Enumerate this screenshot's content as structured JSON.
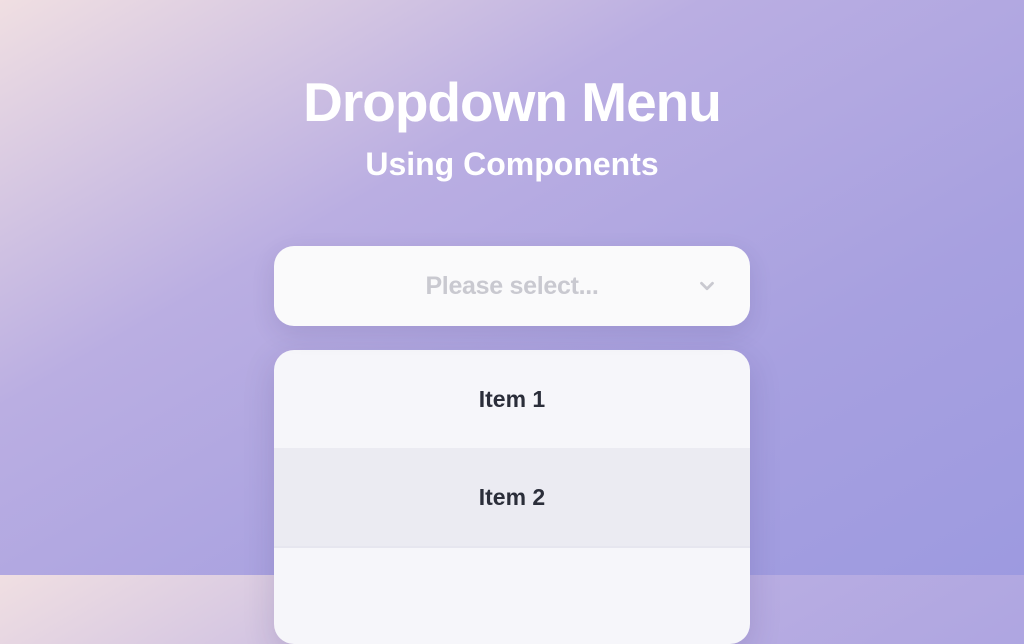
{
  "header": {
    "title": "Dropdown Menu",
    "subtitle": "Using Components"
  },
  "dropdown": {
    "placeholder": "Please select...",
    "items": [
      {
        "label": "Item 1"
      },
      {
        "label": "Item 2"
      }
    ]
  }
}
